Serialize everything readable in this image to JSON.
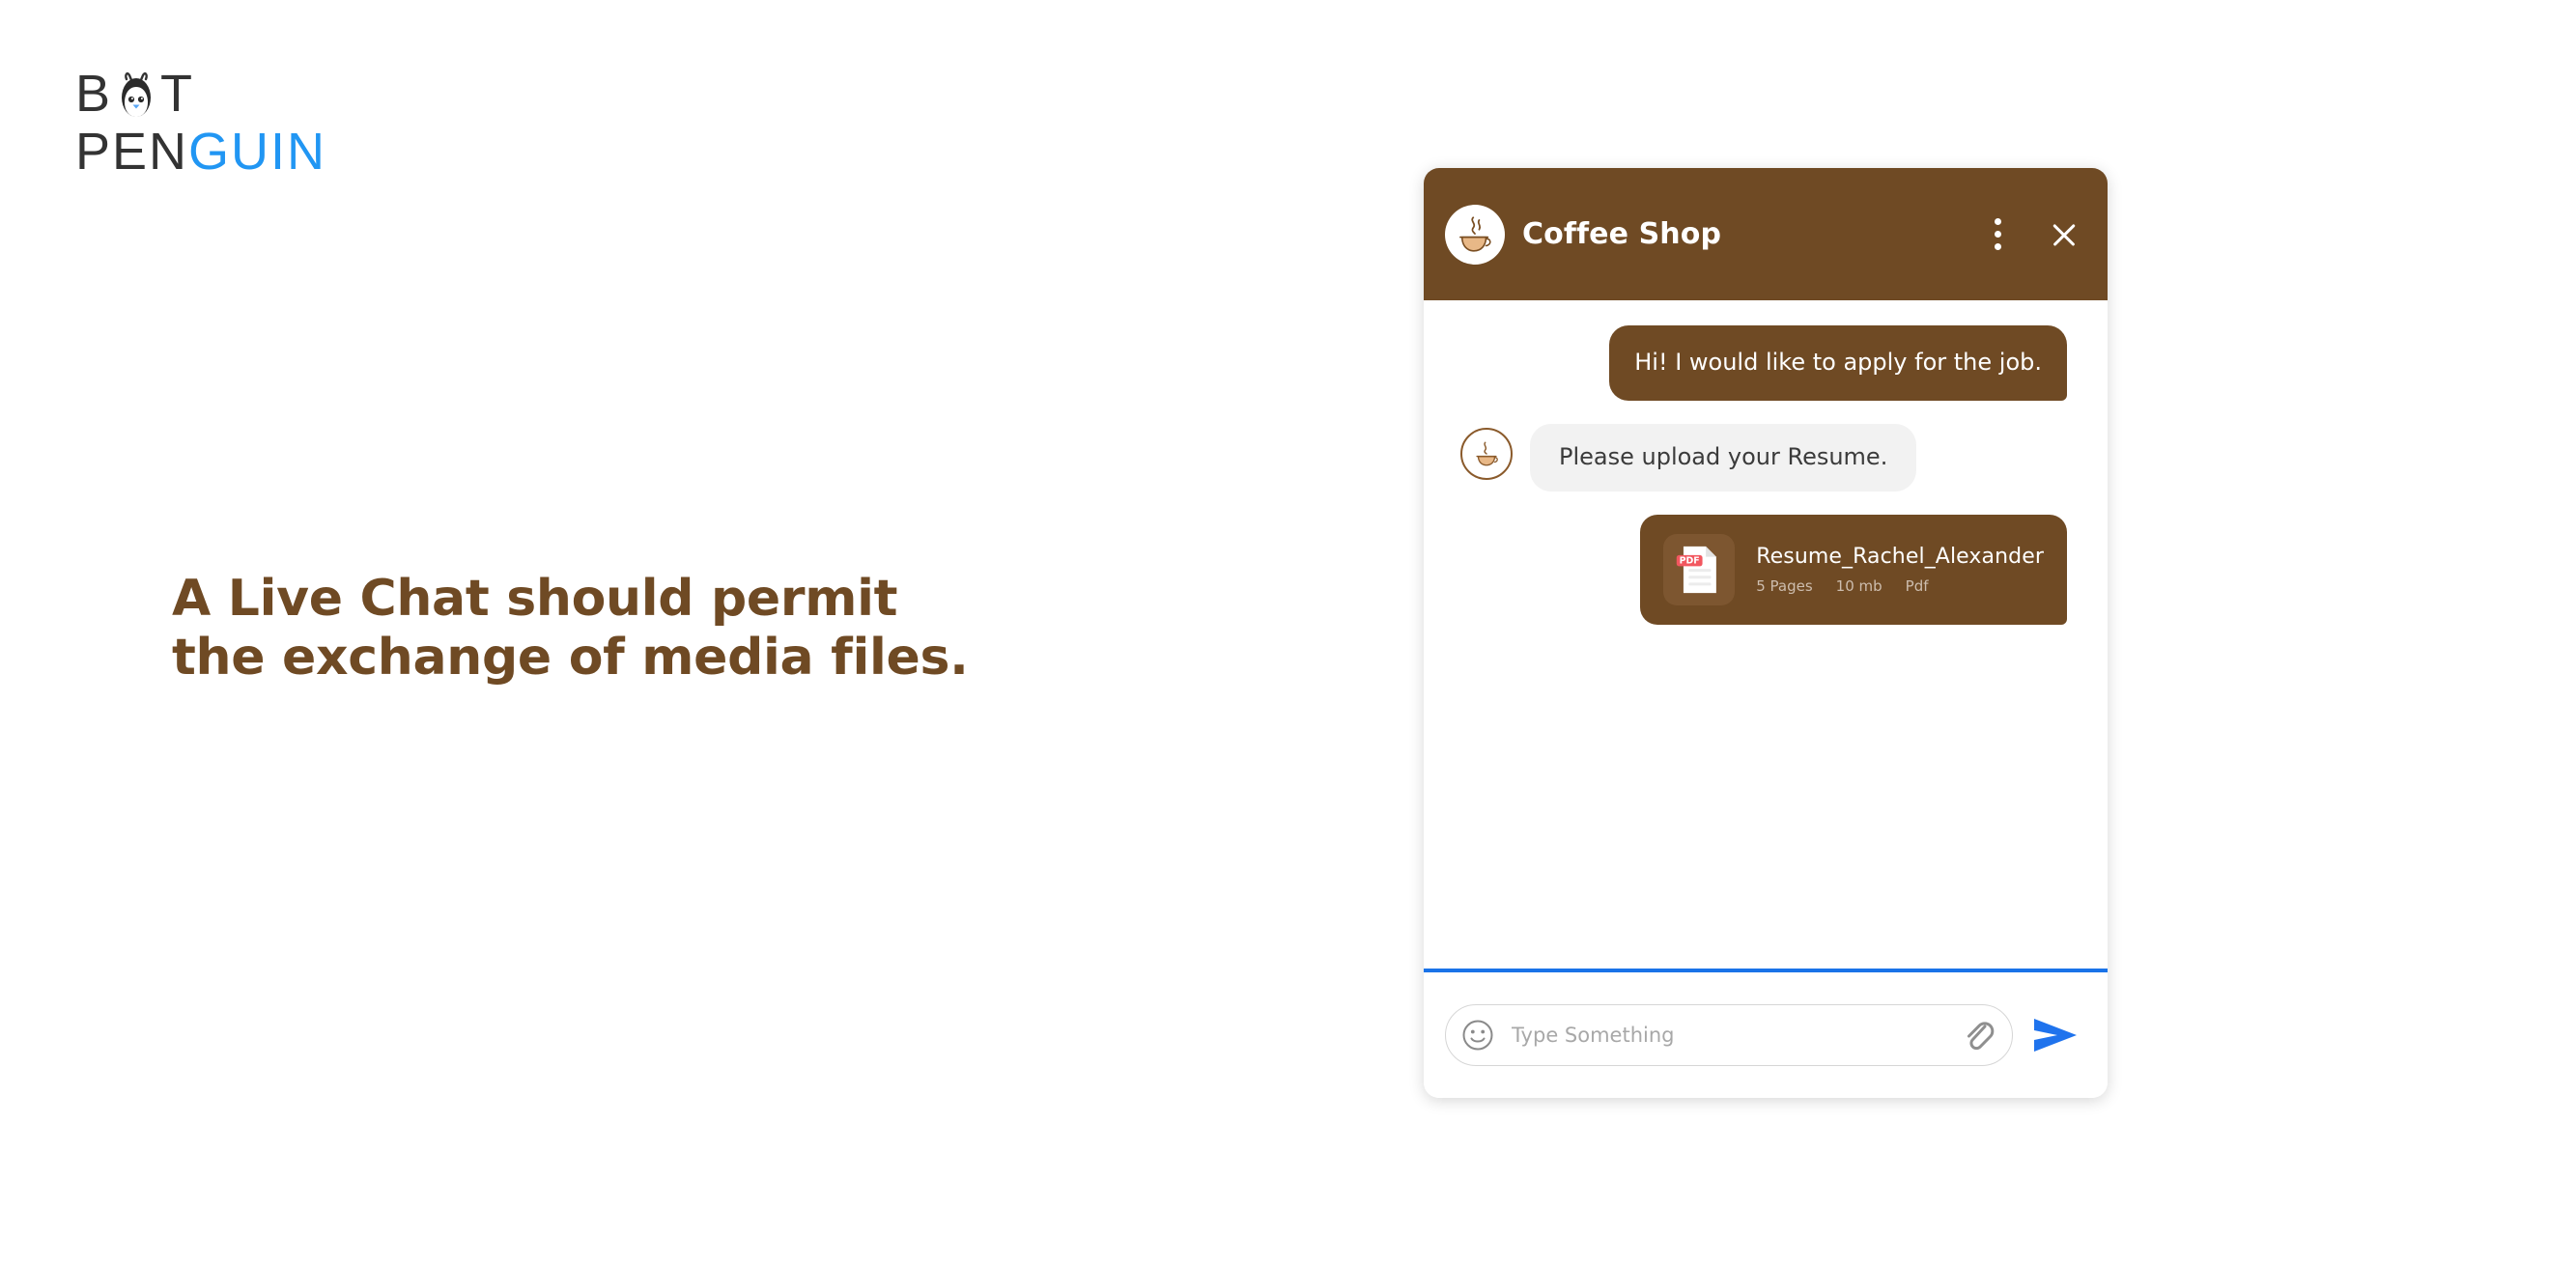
{
  "brand": {
    "logo_line1": [
      "B",
      "penguin-glyph",
      "T"
    ],
    "logo_line2_dark": "PEN",
    "logo_line2_blue": "GUIN",
    "dark_color": "#333333",
    "blue_color": "#2196f3"
  },
  "headline": {
    "line1": "A Live Chat should permit",
    "line2": "the exchange of media files.",
    "color": "#6F4A24"
  },
  "widget": {
    "accent_color": "#6F4A24",
    "divider_color": "#1a73e8",
    "header": {
      "title": "Coffee Shop",
      "avatar_icon": "coffee-cup-icon",
      "menu_icon": "kebab-menu-icon",
      "close_icon": "close-icon"
    },
    "messages": [
      {
        "id": "msg-1",
        "direction": "outgoing",
        "text": "Hi! I would like to apply for the job."
      },
      {
        "id": "msg-2",
        "direction": "incoming",
        "avatar_icon": "coffee-cup-icon",
        "text": "Please upload your Resume."
      }
    ],
    "attachment": {
      "file_name": "Resume_Rachel_Alexander",
      "pages": "5 Pages",
      "size": "10 mb",
      "type": "Pdf",
      "badge_label": "PDF",
      "badge_color": "#f2575f",
      "icon": "pdf-file-icon"
    },
    "input": {
      "placeholder": "Type Something",
      "value": "",
      "emoji_icon": "emoji-smiley-icon",
      "attach_icon": "paperclip-icon",
      "send_icon": "send-arrow-icon"
    }
  }
}
